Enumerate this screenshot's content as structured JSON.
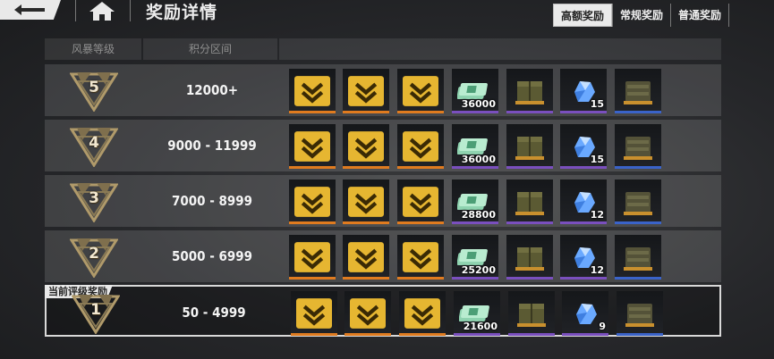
{
  "header": {
    "title": "奖励详情",
    "tabs": [
      {
        "label": "高额奖励",
        "active": true
      },
      {
        "label": "常规奖励",
        "active": false
      },
      {
        "label": "普通奖励",
        "active": false
      }
    ]
  },
  "columns": {
    "rank": "风暴等级",
    "score": "积分区间"
  },
  "current_tag": "当前评级奖励",
  "rows": [
    {
      "rank": "5",
      "score": "12000+",
      "qty": [
        "",
        "",
        "",
        "36000",
        "",
        "15",
        ""
      ]
    },
    {
      "rank": "4",
      "score": "9000 - 11999",
      "qty": [
        "",
        "",
        "",
        "36000",
        "",
        "15",
        ""
      ]
    },
    {
      "rank": "3",
      "score": "7000 - 8999",
      "qty": [
        "",
        "",
        "",
        "28800",
        "",
        "12",
        ""
      ]
    },
    {
      "rank": "2",
      "score": "5000 - 6999",
      "qty": [
        "",
        "",
        "",
        "25200",
        "",
        "12",
        ""
      ]
    },
    {
      "rank": "1",
      "score": "50 - 4999",
      "qty": [
        "",
        "",
        "",
        "21600",
        "",
        "9",
        ""
      ],
      "current": true
    }
  ],
  "reward_items": [
    {
      "icon": "dark-armor-crate-icon",
      "rarity": "orange",
      "badge": true
    },
    {
      "icon": "gold-armor-crate-icon",
      "rarity": "orange",
      "badge": true
    },
    {
      "icon": "red-armor-crate-icon",
      "rarity": "orange",
      "badge": true
    },
    {
      "icon": "cash-stack-icon",
      "rarity": "purple",
      "badge": false
    },
    {
      "icon": "supply-box-icon",
      "rarity": "purple",
      "badge": false
    },
    {
      "icon": "blue-crystal-icon",
      "rarity": "purple",
      "badge": false
    },
    {
      "icon": "supply-crate-icon",
      "rarity": "blue",
      "badge": false
    }
  ],
  "colors": {
    "orange": "#e07b1f",
    "purple": "#7a4fbe",
    "blue": "#3a63c9",
    "emblem_gold": "#b09a6a"
  }
}
